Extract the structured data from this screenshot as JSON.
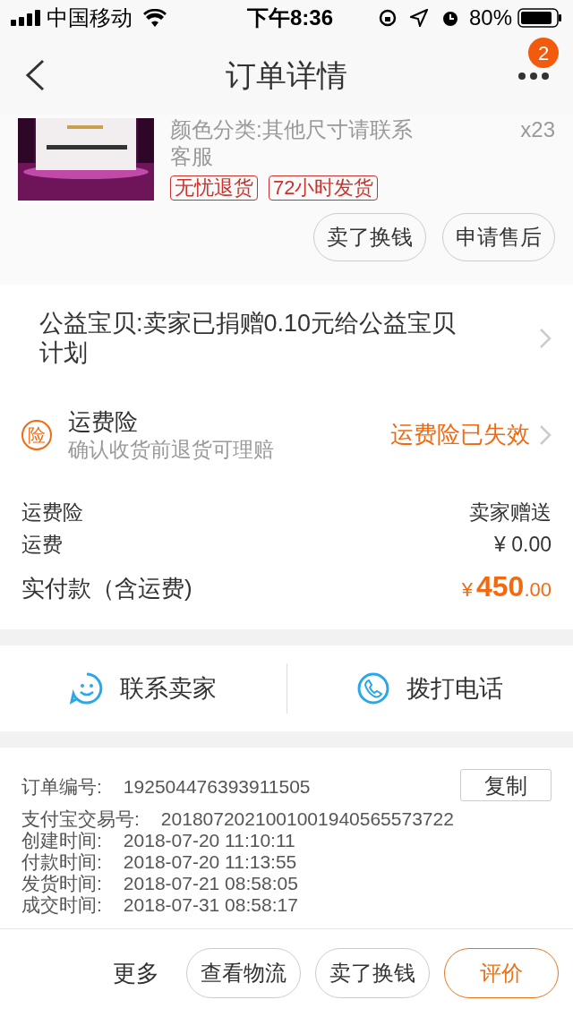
{
  "status_bar": {
    "carrier": "中国移动",
    "time": "下午8:36",
    "battery": "80%"
  },
  "nav": {
    "title": "订单详情",
    "badge": "2"
  },
  "product": {
    "image": {
      "kind": "picture"
    },
    "spec": "颜色分类:其他尺寸请联系客服",
    "quantity": "x23",
    "tags": [
      "无忧退货",
      "72小时发货"
    ],
    "buttons": [
      "卖了换钱",
      "申请售后"
    ]
  },
  "charity": {
    "text": "公益宝贝:卖家已捐赠0.10元给公益宝贝计划"
  },
  "insurance": {
    "icon_text": "险",
    "title": "运费险",
    "subtitle": "确认收货前退货可理赔",
    "status": "运费险已失效"
  },
  "fees": [
    {
      "label": "运费险",
      "value": "卖家赠送",
      "kind": "plain"
    },
    {
      "label": "运费",
      "value": "¥ 0.00",
      "kind": "plain"
    },
    {
      "label": "实付款（含运费)",
      "currency": "¥",
      "amount": "450",
      "cents": ".00",
      "kind": "total"
    }
  ],
  "contact": [
    {
      "label": "联系卖家",
      "kind": "chat"
    },
    {
      "label": "拨打电话",
      "kind": "phone"
    }
  ],
  "order_info": {
    "copy_button": "复制",
    "rows": [
      {
        "label": "订单编号:",
        "value": "192504476393911505"
      },
      {
        "label": "支付宝交易号:",
        "value": "2018072021001001940565573722"
      },
      {
        "label": "创建时间:",
        "value": "2018-07-20 11:10:11"
      },
      {
        "label": "付款时间:",
        "value": "2018-07-20 11:13:55"
      },
      {
        "label": "发货时间:",
        "value": "2018-07-21 08:58:05"
      },
      {
        "label": "成交时间:",
        "value": "2018-07-31 08:58:17"
      }
    ]
  },
  "bottom_bar": {
    "more": "更多",
    "buttons": [
      {
        "label": "查看物流",
        "primary": false
      },
      {
        "label": "卖了换钱",
        "primary": false
      },
      {
        "label": "评价",
        "primary": true
      }
    ]
  }
}
